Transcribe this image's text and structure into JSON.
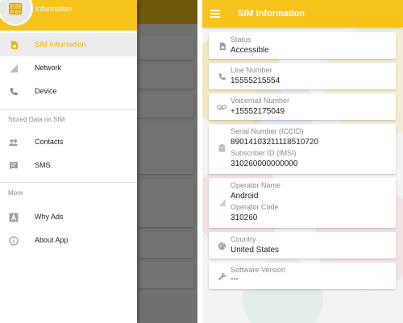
{
  "drawer": {
    "header_title": "Information",
    "items": [
      {
        "label": "SIM Information",
        "icon": "sim-card-icon",
        "active": true
      },
      {
        "label": "Network",
        "icon": "signal-icon",
        "active": false
      },
      {
        "label": "Device",
        "icon": "phone-icon",
        "active": false
      }
    ],
    "section_stored": "Stored Data on SIM",
    "stored_items": [
      {
        "label": "Contacts",
        "icon": "people-icon"
      },
      {
        "label": "SMS",
        "icon": "message-icon"
      }
    ],
    "section_more": "More",
    "more_items": [
      {
        "label": "Why Ads",
        "icon": "font-a-icon"
      },
      {
        "label": "About App",
        "icon": "info-icon"
      }
    ]
  },
  "appbar": {
    "title": "SIM Information",
    "menu_icon": "hamburger-menu-icon"
  },
  "cards": {
    "status": {
      "label": "Status",
      "value": "Accessible",
      "icon": "sim-card-icon"
    },
    "line_number": {
      "label": "Line Number",
      "value": "15555215554",
      "icon": "phone-icon"
    },
    "voicemail": {
      "label": "Voicemail Number",
      "value": "+15552175049",
      "icon": "voicemail-icon"
    },
    "serial": {
      "label": "Serial Number (ICCID)",
      "value": "89014103211118510720",
      "label2": "Subscriber ID (IMSI)",
      "value2": "310260000000000",
      "icon": "android-icon"
    },
    "operator": {
      "label": "Operator Name",
      "value": "Android",
      "label2": "Operator Code",
      "value2": "310260",
      "icon": "signal-icon"
    },
    "country": {
      "label": "Country",
      "value": "United States",
      "icon": "globe-icon"
    },
    "software": {
      "label": "Software Version",
      "value": "---",
      "icon": "wrench-icon"
    }
  },
  "colors": {
    "accent": "#f6c21c",
    "active_text": "#f1b300",
    "label_gray": "#8a8a8a"
  }
}
